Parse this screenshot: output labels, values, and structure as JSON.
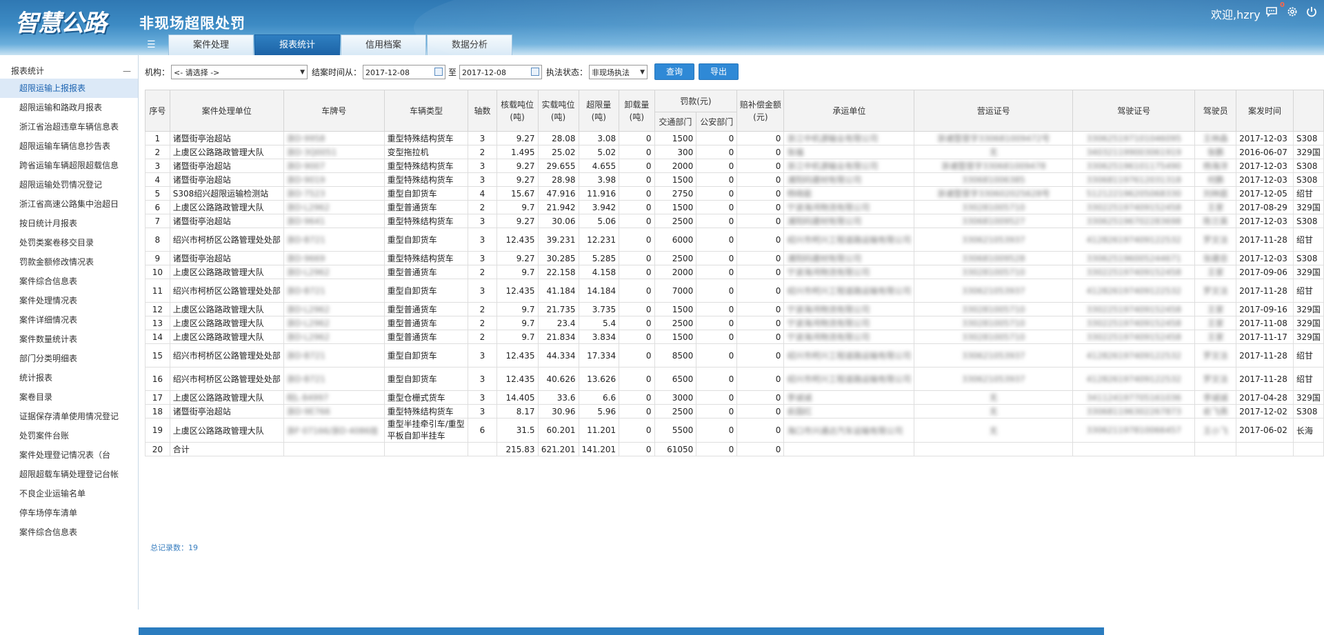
{
  "header": {
    "logo_text": "智慧公路",
    "app_title": "非现场超限处罚",
    "welcome": "欢迎,hzry",
    "message_badge": "0",
    "icons": [
      "menu-toggle-icon",
      "message-icon",
      "settings-icon",
      "power-icon"
    ]
  },
  "tabs": [
    {
      "label": "案件处理",
      "active": false
    },
    {
      "label": "报表统计",
      "active": true
    },
    {
      "label": "信用档案",
      "active": false
    },
    {
      "label": "数据分析",
      "active": false
    }
  ],
  "sidebar": {
    "title": "报表统计",
    "collapse_symbol": "—",
    "items": [
      {
        "label": "超限运输上报报表",
        "active": true
      },
      {
        "label": "超限运输和路政月报表"
      },
      {
        "label": "浙江省治超违章车辆信息表"
      },
      {
        "label": "超限运输车辆信息抄告表"
      },
      {
        "label": "跨省运输车辆超限超载信息"
      },
      {
        "label": "超限运输处罚情况登记"
      },
      {
        "label": "浙江省高速公路集中治超日"
      },
      {
        "label": "按日统计月报表"
      },
      {
        "label": "处罚类案卷移交目录"
      },
      {
        "label": "罚款金额修改情况表"
      },
      {
        "label": "案件综合信息表"
      },
      {
        "label": "案件处理情况表"
      },
      {
        "label": "案件详细情况表"
      },
      {
        "label": "案件数量统计表"
      },
      {
        "label": "部门分类明细表"
      },
      {
        "label": "统计报表"
      },
      {
        "label": "案卷目录"
      },
      {
        "label": "证据保存清单使用情况登记"
      },
      {
        "label": "处罚案件台账"
      },
      {
        "label": "案件处理登记情况表（台"
      },
      {
        "label": "超限超载车辆处理登记台帐"
      },
      {
        "label": "不良企业运输名单"
      },
      {
        "label": "停车场停车清单"
      },
      {
        "label": "案件综合信息表"
      }
    ]
  },
  "filter": {
    "org_label": "机构：",
    "org_value": "<- 请选择 ->",
    "date_label": "结案时间从：",
    "date_from": "2017-12-08",
    "to_label": "至",
    "date_to": "2017-12-08",
    "status_label": "执法状态：",
    "status_value": "非现场执法",
    "query_button": "查询",
    "export_button": "导出"
  },
  "table": {
    "headers": {
      "seq": "序号",
      "unit": "案件处理单位",
      "plate": "车牌号",
      "vtype": "车辆类型",
      "axles": "轴数",
      "rated": "核载吨位(吨)",
      "actual": "实载吨位(吨)",
      "over": "超限量(吨)",
      "unload": "卸载量(吨)",
      "fine": "罚款(元)",
      "fine_traffic": "交通部门",
      "fine_police": "公安部门",
      "comp": "赔补偿金额(元)",
      "carrier": "承运单位",
      "license": "营运证号",
      "driver_license": "驾驶证号",
      "driver": "驾驶员",
      "time": "案发时间",
      "place": ""
    },
    "rows": [
      {
        "seq": "1",
        "unit": "诸暨街亭治超站",
        "plate": "浙D·9958",
        "vtype": "重型特殊结构货车",
        "axles": "3",
        "rated": "9.27",
        "actual": "28.08",
        "over": "3.08",
        "unload": "0",
        "fine_traffic": "1500",
        "fine_police": "0",
        "comp": "0",
        "carrier": "浙江中机源输业有限公司",
        "license": "浙诸暨营字330681009472号",
        "driver_license": "330625197101046095",
        "driver": "王林森",
        "time": "2017-12-03",
        "place": "S308"
      },
      {
        "seq": "2",
        "unit": "上虞区公路路政管理大队",
        "plate": "浙D·3Q0051",
        "vtype": "变型拖拉机",
        "axles": "2",
        "rated": "1.495",
        "actual": "25.02",
        "over": "5.02",
        "unload": "0",
        "fine_traffic": "300",
        "fine_police": "0",
        "comp": "0",
        "carrier": "张福",
        "license": "无",
        "driver_license": "340321199003061919",
        "driver": "张鹏",
        "time": "2016-06-07",
        "place": "329国"
      },
      {
        "seq": "3",
        "unit": "诸暨街亭治超站",
        "plate": "浙D·9007",
        "vtype": "重型特殊结构货车",
        "axles": "3",
        "rated": "9.27",
        "actual": "29.655",
        "over": "4.655",
        "unload": "0",
        "fine_traffic": "2000",
        "fine_police": "0",
        "comp": "0",
        "carrier": "浙江中机源输业有限公司",
        "license": "浙诸暨营字330681009478",
        "driver_license": "330625196101175490",
        "driver": "杨海洋",
        "time": "2017-12-03",
        "place": "S308"
      },
      {
        "seq": "4",
        "unit": "诸暨街亭治超站",
        "plate": "浙D·9019",
        "vtype": "重型特殊结构货车",
        "axles": "3",
        "rated": "9.27",
        "actual": "28.98",
        "over": "3.98",
        "unload": "0",
        "fine_traffic": "1500",
        "fine_police": "0",
        "comp": "0",
        "carrier": "浦阳码建材有限公司",
        "license": "330681006385",
        "driver_license": "330681197612031318",
        "driver": "何鹏",
        "time": "2017-12-03",
        "place": "S308"
      },
      {
        "seq": "5",
        "unit": "S308绍兴超限运输检测站",
        "plate": "浙D·7523",
        "vtype": "重型自卸货车",
        "axles": "4",
        "rated": "15.67",
        "actual": "47.916",
        "over": "11.916",
        "unload": "0",
        "fine_traffic": "2750",
        "fine_police": "0",
        "comp": "0",
        "carrier": "杨晓能",
        "license": "浙诸暨营字330602025628号",
        "driver_license": "512122196205068330",
        "driver": "刘林庭",
        "time": "2017-12-05",
        "place": "绍甘"
      },
      {
        "seq": "6",
        "unit": "上虞区公路路政管理大队",
        "plate": "浙D·L2962",
        "vtype": "重型普通货车",
        "axles": "2",
        "rated": "9.7",
        "actual": "21.942",
        "over": "3.942",
        "unload": "0",
        "fine_traffic": "1500",
        "fine_police": "0",
        "comp": "0",
        "carrier": "宁波海鸿物流有限公司",
        "license": "330281005710",
        "driver_license": "330225197409152458",
        "driver": "王家",
        "time": "2017-08-29",
        "place": "329国"
      },
      {
        "seq": "7",
        "unit": "诸暨街亭治超站",
        "plate": "浙D·9641",
        "vtype": "重型特殊结构货车",
        "axles": "3",
        "rated": "9.27",
        "actual": "30.06",
        "over": "5.06",
        "unload": "0",
        "fine_traffic": "2500",
        "fine_police": "0",
        "comp": "0",
        "carrier": "浦阳码建材有限公司",
        "license": "330681009527",
        "driver_license": "330625196702283698",
        "driver": "陈兰英",
        "time": "2017-12-03",
        "place": "S308"
      },
      {
        "seq": "8",
        "unit": "绍兴市柯桥区公路管理处处部",
        "plate": "浙D·B721",
        "vtype": "重型自卸货车",
        "axles": "3",
        "rated": "12.435",
        "actual": "39.231",
        "over": "12.231",
        "unload": "0",
        "fine_traffic": "6000",
        "fine_police": "0",
        "comp": "0",
        "carrier": "绍兴市柯兴工程道路运输有限公司",
        "license": "330621053937",
        "driver_license": "412826197409122532",
        "driver": "罗文法",
        "time": "2017-11-28",
        "place": "绍甘"
      },
      {
        "seq": "9",
        "unit": "诸暨街亭治超站",
        "plate": "浙D·9669",
        "vtype": "重型特殊结构货车",
        "axles": "3",
        "rated": "9.27",
        "actual": "30.285",
        "over": "5.285",
        "unload": "0",
        "fine_traffic": "2500",
        "fine_police": "0",
        "comp": "0",
        "carrier": "浦阳码建材有限公司",
        "license": "330681009528",
        "driver_license": "330625196005244671",
        "driver": "张建忠",
        "time": "2017-12-03",
        "place": "S308"
      },
      {
        "seq": "10",
        "unit": "上虞区公路路政管理大队",
        "plate": "浙D·L2962",
        "vtype": "重型普通货车",
        "axles": "2",
        "rated": "9.7",
        "actual": "22.158",
        "over": "4.158",
        "unload": "0",
        "fine_traffic": "2000",
        "fine_police": "0",
        "comp": "0",
        "carrier": "宁波海鸿物流有限公司",
        "license": "330281005710",
        "driver_license": "330225197409152458",
        "driver": "王家",
        "time": "2017-09-06",
        "place": "329国"
      },
      {
        "seq": "11",
        "unit": "绍兴市柯桥区公路管理处处部",
        "plate": "浙D·B721",
        "vtype": "重型自卸货车",
        "axles": "3",
        "rated": "12.435",
        "actual": "41.184",
        "over": "14.184",
        "unload": "0",
        "fine_traffic": "7000",
        "fine_police": "0",
        "comp": "0",
        "carrier": "绍兴市柯兴工程道路运输有限公司",
        "license": "330621053937",
        "driver_license": "412826197409122532",
        "driver": "罗文法",
        "time": "2017-11-28",
        "place": "绍甘"
      },
      {
        "seq": "12",
        "unit": "上虞区公路路政管理大队",
        "plate": "浙D·L2962",
        "vtype": "重型普通货车",
        "axles": "2",
        "rated": "9.7",
        "actual": "21.735",
        "over": "3.735",
        "unload": "0",
        "fine_traffic": "1500",
        "fine_police": "0",
        "comp": "0",
        "carrier": "宁波海鸿物流有限公司",
        "license": "330281005710",
        "driver_license": "330225197409152458",
        "driver": "王家",
        "time": "2017-09-16",
        "place": "329国"
      },
      {
        "seq": "13",
        "unit": "上虞区公路路政管理大队",
        "plate": "浙D·L2962",
        "vtype": "重型普通货车",
        "axles": "2",
        "rated": "9.7",
        "actual": "23.4",
        "over": "5.4",
        "unload": "0",
        "fine_traffic": "2500",
        "fine_police": "0",
        "comp": "0",
        "carrier": "宁波海鸿物流有限公司",
        "license": "330281005710",
        "driver_license": "330225197409152458",
        "driver": "王家",
        "time": "2017-11-08",
        "place": "329国"
      },
      {
        "seq": "14",
        "unit": "上虞区公路路政管理大队",
        "plate": "浙D·L2962",
        "vtype": "重型普通货车",
        "axles": "2",
        "rated": "9.7",
        "actual": "21.834",
        "over": "3.834",
        "unload": "0",
        "fine_traffic": "1500",
        "fine_police": "0",
        "comp": "0",
        "carrier": "宁波海鸿物流有限公司",
        "license": "330281005710",
        "driver_license": "330225197409152458",
        "driver": "王家",
        "time": "2017-11-17",
        "place": "329国"
      },
      {
        "seq": "15",
        "unit": "绍兴市柯桥区公路管理处处部",
        "plate": "浙D·B721",
        "vtype": "重型自卸货车",
        "axles": "3",
        "rated": "12.435",
        "actual": "44.334",
        "over": "17.334",
        "unload": "0",
        "fine_traffic": "8500",
        "fine_police": "0",
        "comp": "0",
        "carrier": "绍兴市柯兴工程道路运输有限公司",
        "license": "330621053937",
        "driver_license": "412826197409122532",
        "driver": "罗文法",
        "time": "2017-11-28",
        "place": "绍甘"
      },
      {
        "seq": "16",
        "unit": "绍兴市柯桥区公路管理处处部",
        "plate": "浙D·B721",
        "vtype": "重型自卸货车",
        "axles": "3",
        "rated": "12.435",
        "actual": "40.626",
        "over": "13.626",
        "unload": "0",
        "fine_traffic": "6500",
        "fine_police": "0",
        "comp": "0",
        "carrier": "绍兴市柯兴工程道路运输有限公司",
        "license": "330621053937",
        "driver_license": "412826197409122532",
        "driver": "罗文法",
        "time": "2017-11-28",
        "place": "绍甘"
      },
      {
        "seq": "17",
        "unit": "上虞区公路路政管理大队",
        "plate": "皖L·84997",
        "vtype": "重型仓栅式货车",
        "axles": "3",
        "rated": "14.405",
        "actual": "33.6",
        "over": "6.6",
        "unload": "0",
        "fine_traffic": "3000",
        "fine_police": "0",
        "comp": "0",
        "carrier": "李诚诚",
        "license": "无",
        "driver_license": "341124197705161036",
        "driver": "李诚诚",
        "time": "2017-04-28",
        "place": "329国"
      },
      {
        "seq": "18",
        "unit": "诸暨街亭治超站",
        "plate": "浙D·9E766",
        "vtype": "重型特殊结构货车",
        "axles": "3",
        "rated": "8.17",
        "actual": "30.96",
        "over": "5.96",
        "unload": "0",
        "fine_traffic": "2500",
        "fine_police": "0",
        "comp": "0",
        "carrier": "俞国红",
        "license": "无",
        "driver_license": "330681196302267873",
        "driver": "俞飞燕",
        "time": "2017-12-02",
        "place": "S308"
      },
      {
        "seq": "19",
        "unit": "上虞区公路路政管理大队",
        "plate": "浙F·07166/浙D·4086挂",
        "vtype": "重型半挂牵引车/重型平板自卸半挂车",
        "axles": "6",
        "rated": "31.5",
        "actual": "60.201",
        "over": "11.201",
        "unload": "0",
        "fine_traffic": "5500",
        "fine_police": "0",
        "comp": "0",
        "carrier": "海口市兴通达汽车运输有限公司",
        "license": "无",
        "driver_license": "330621197810066457",
        "driver": "王小飞",
        "time": "2017-06-02",
        "place": "长海"
      },
      {
        "seq": "20",
        "unit": "合计",
        "plate": "",
        "vtype": "",
        "axles": "",
        "rated": "215.83",
        "actual": "621.201",
        "over": "141.201",
        "unload": "0",
        "fine_traffic": "61050",
        "fine_police": "0",
        "comp": "0",
        "carrier": "",
        "license": "",
        "driver_license": "",
        "driver": "",
        "time": "",
        "place": ""
      }
    ],
    "total_label": "总记录数：19"
  },
  "colors": {
    "header_blue": "#2f78b3",
    "active_tab": "#1c63a6",
    "button_blue": "#2f89d6",
    "sidebar_active_bg": "#dce9f7",
    "link_blue": "#3a7fc0"
  }
}
